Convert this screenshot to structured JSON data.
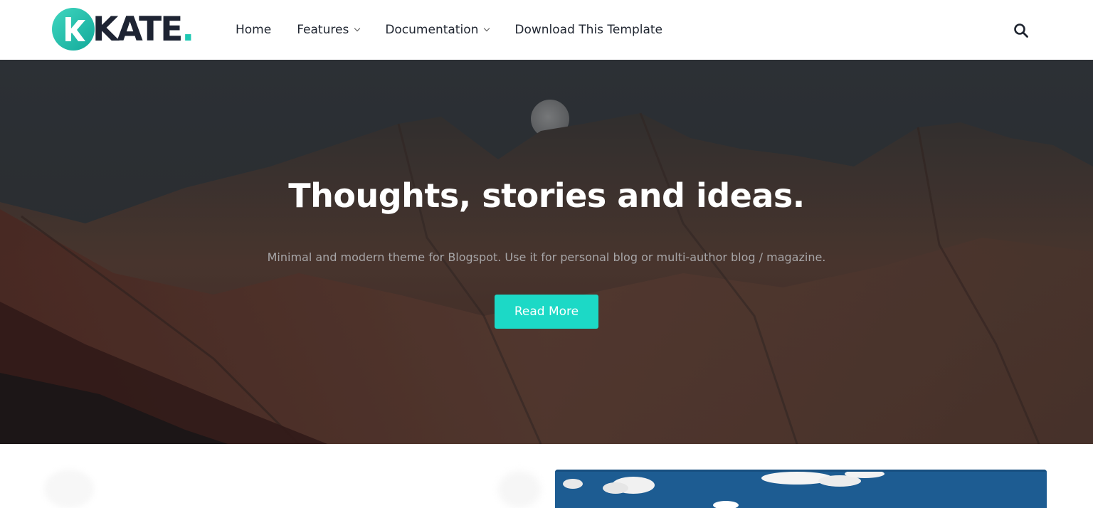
{
  "header": {
    "logo": {
      "word": "KATE",
      "dot": ".",
      "mark_letter": "k"
    },
    "nav": [
      {
        "label": "Home",
        "has_dropdown": false
      },
      {
        "label": "Features",
        "has_dropdown": true
      },
      {
        "label": "Documentation",
        "has_dropdown": true
      },
      {
        "label": "Download This Template",
        "has_dropdown": false
      }
    ],
    "search_icon": "search-icon"
  },
  "hero": {
    "title": "Thoughts, stories and ideas.",
    "subtitle": "Minimal and modern theme for Blogspot. Use it for personal blog or multi-author blog / magazine.",
    "button_label": "Read More"
  },
  "colors": {
    "accent": "#1cd9c6",
    "logo_teal": "#1ec8b3",
    "text_dark": "#1e2433",
    "hero_overlay": "#3a3d40"
  }
}
